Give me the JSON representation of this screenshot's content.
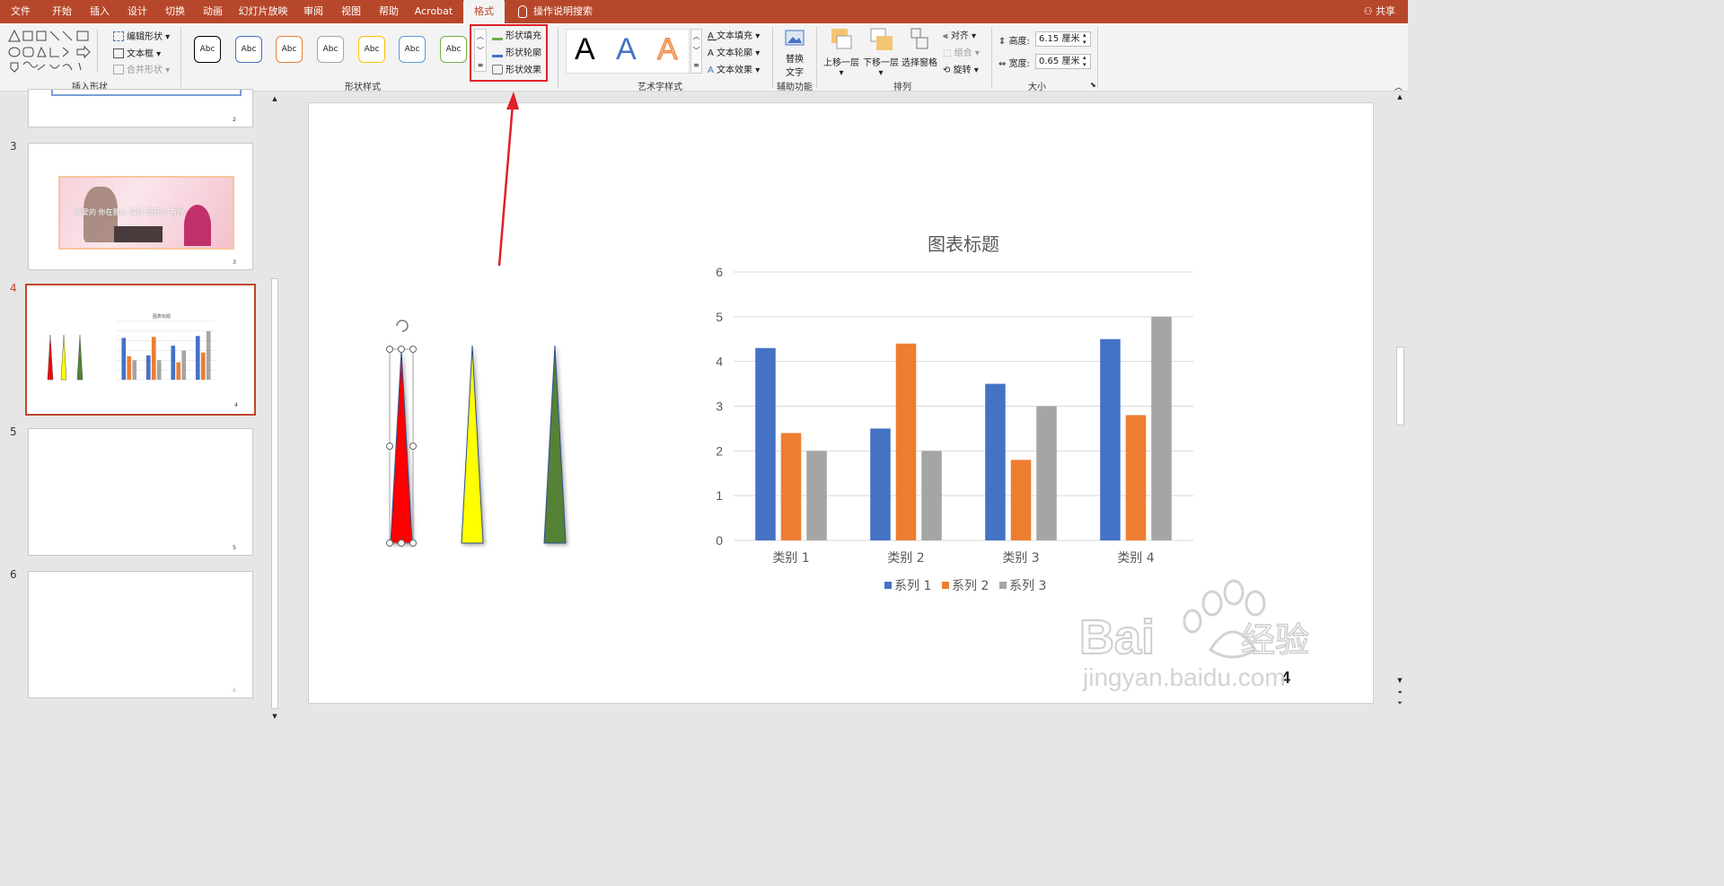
{
  "tabs": [
    "文件",
    "开始",
    "插入",
    "设计",
    "切换",
    "动画",
    "幻灯片放映",
    "审阅",
    "视图",
    "帮助",
    "Acrobat",
    "格式"
  ],
  "active_tab": "格式",
  "tell_me": "操作说明搜索",
  "share": "共享",
  "ribbon": {
    "insert_shapes": {
      "label": "插入形状",
      "edit_shape": "编辑形状",
      "text_box": "文本框",
      "merge_shapes": "合并形状"
    },
    "shape_styles": {
      "label": "形状样式",
      "preset": "Abc",
      "fill": "形状填充",
      "outline": "形状轮廓",
      "effects": "形状效果"
    },
    "wordart": {
      "label": "艺术字样式",
      "glyph": "A",
      "text_fill": "文本填充",
      "text_outline": "文本轮廓",
      "text_effects": "文本效果"
    },
    "accessibility": {
      "label": "辅助功能",
      "alt_text_1": "替换",
      "alt_text_2": "文字"
    },
    "arrange": {
      "label": "排列",
      "bring_forward": "上移一层",
      "send_backward": "下移一层",
      "selection_pane": "选择窗格",
      "align": "对齐",
      "group": "组合",
      "rotate": "旋转"
    },
    "size": {
      "label": "大小",
      "height_label": "高度:",
      "height_value": "6.15 厘米",
      "width_label": "宽度:",
      "width_value": "0.65 厘米"
    }
  },
  "colors": {
    "accent": "#b7472a",
    "highlight": "#e0202a",
    "series1": "#4472c4",
    "series2": "#ed7d31",
    "series3": "#a5a5a5"
  },
  "thumbnails": [
    {
      "num": "2",
      "page": "2"
    },
    {
      "num": "3",
      "page": "3",
      "text": "亲爱的 你在我心 深处 很开心 有你"
    },
    {
      "num": "4",
      "page": "4",
      "title": "图表标题"
    },
    {
      "num": "5",
      "page": "5"
    },
    {
      "num": "6",
      "page": "6"
    }
  ],
  "slide": {
    "page_number": "4",
    "triangles": [
      "#ff0000",
      "#ffff00",
      "#548235"
    ]
  },
  "chart_data": {
    "type": "bar",
    "title": "图表标题",
    "categories": [
      "类别 1",
      "类别 2",
      "类别 3",
      "类别 4"
    ],
    "series": [
      {
        "name": "系列 1",
        "values": [
          4.3,
          2.5,
          3.5,
          4.5
        ]
      },
      {
        "name": "系列 2",
        "values": [
          2.4,
          4.4,
          1.8,
          2.8
        ]
      },
      {
        "name": "系列 3",
        "values": [
          2.0,
          2.0,
          3.0,
          5.0
        ]
      }
    ],
    "ylim": [
      0,
      6
    ],
    "yticks": [
      "0",
      "1",
      "2",
      "3",
      "4",
      "5",
      "6"
    ],
    "grid": true,
    "legend": "bottom"
  },
  "watermark": {
    "brand": "Bai",
    "cn": "经验",
    "url": "jingyan.baidu.com"
  }
}
